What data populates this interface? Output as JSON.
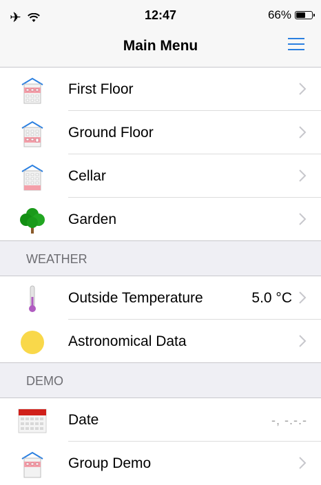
{
  "status_bar": {
    "time": "12:47",
    "battery": "66%",
    "battery_level": 0.66
  },
  "nav": {
    "title": "Main Menu",
    "menu_icon": "hamburger-menu-icon"
  },
  "rows_top": [
    {
      "label": "First Floor",
      "icon": "house-first-floor-icon"
    },
    {
      "label": "Ground Floor",
      "icon": "house-ground-floor-icon"
    },
    {
      "label": "Cellar",
      "icon": "house-cellar-icon"
    },
    {
      "label": "Garden",
      "icon": "tree-icon"
    }
  ],
  "weather_section": {
    "title": "WEATHER",
    "rows": [
      {
        "label": "Outside Temperature",
        "value": "5.0 °C",
        "icon": "thermometer-icon"
      },
      {
        "label": "Astronomical Data",
        "icon": "sun-icon"
      }
    ]
  },
  "demo_section": {
    "title": "DEMO",
    "rows": [
      {
        "label": "Date",
        "value": "-, -.-.-",
        "icon": "calendar-icon"
      },
      {
        "label": "Group Demo",
        "icon": "house-group-icon"
      }
    ]
  },
  "colors": {
    "accent": "#2a7fe0",
    "house_highlight": "#f4a0aa",
    "tree_green": "#1a9a1a",
    "sun": "#f9d84a",
    "thermo": "#b05cc0",
    "calendar_red": "#d0201a"
  }
}
